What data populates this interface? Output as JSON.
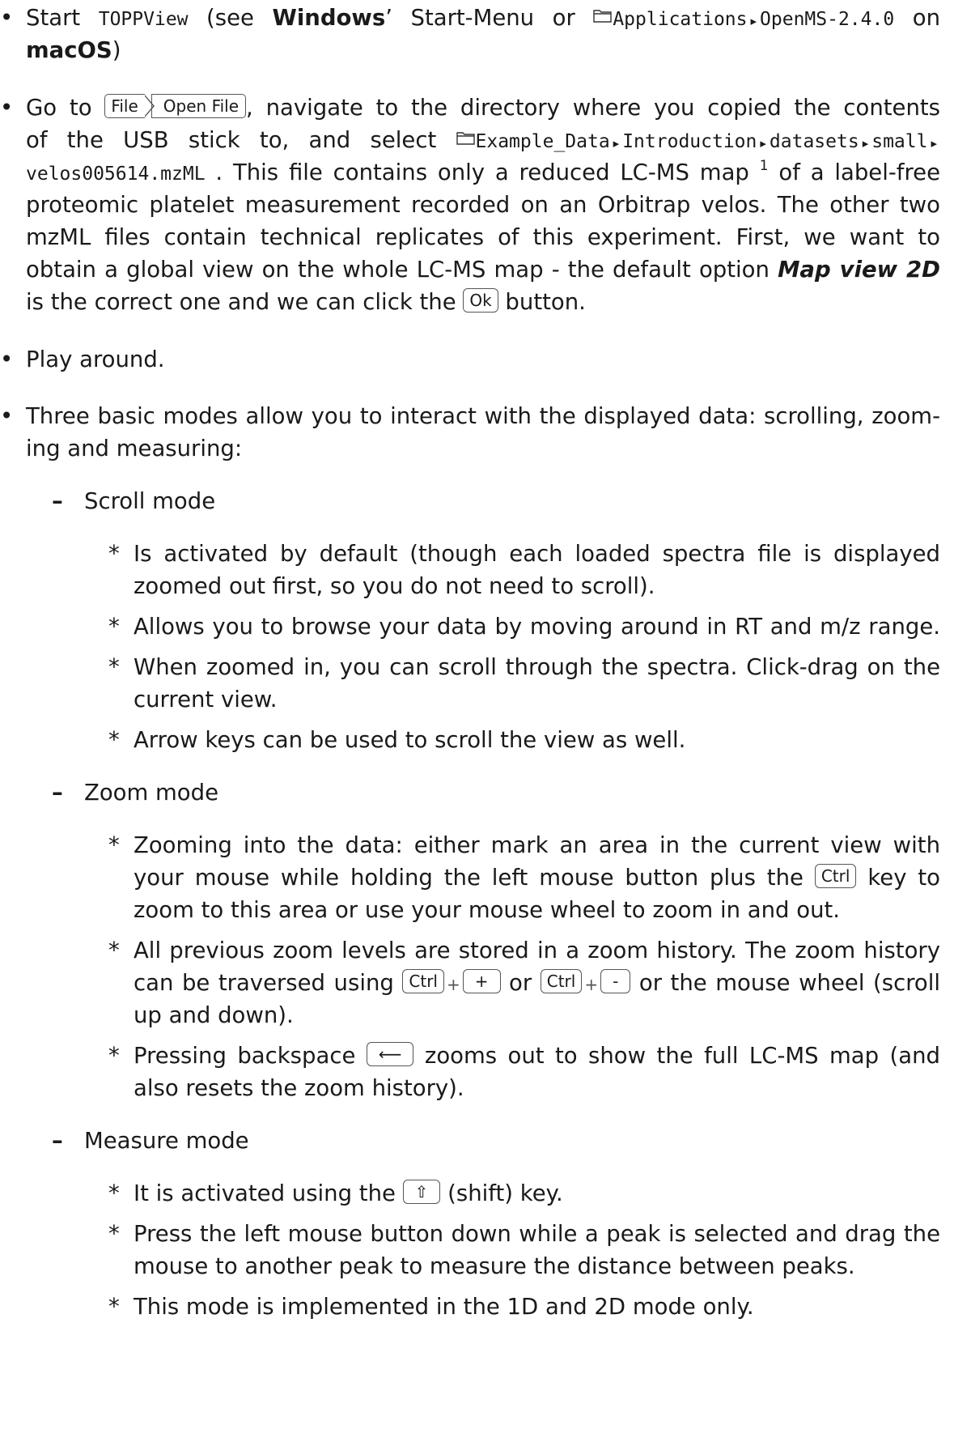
{
  "i1": {
    "a": "Start ",
    "tool": "TOPPView",
    "b": " (see ",
    "os1": "Windows",
    "c": "’ Start-Menu or ",
    "p1": "Applications",
    "p2": "OpenMS-2.4.0",
    "d": " on",
    "os2": "macOS",
    "e": ")"
  },
  "i2": {
    "a": "Go to ",
    "m1": "File",
    "m2": "Open File",
    "b": ", navigate to the directory where you copied the contents",
    "c": "of the USB stick to, and select ",
    "f1": "Example_Data",
    "f2": "Introduction",
    "f3": "datasets",
    "f4": "small",
    "f5": "velos005614.mzML",
    "d": " . This file contains only a reduced LC-MS map ",
    "fn": "1",
    "e": " of a label-free",
    "l3": "proteomic platelet measurement recorded on an Orbitrap velos. The other two",
    "l4": "mzML files contain technical replicates of this experiment.  First, we want to",
    "l5": "obtain a global view on the whole LC-MS map - the default option ",
    "l5em": "Map view 2D",
    "l6a": "is the correct one and we can click the ",
    "ok": "Ok",
    "l6b": " button."
  },
  "i3": {
    "t": "Play around."
  },
  "i4": {
    "l1": "Three basic modes allow you to interact with the displayed data: scrolling, zoom-",
    "l2": "ing and measuring:"
  },
  "scroll": {
    "title": "Scroll mode",
    "s1a": "Is activated by default (though each loaded spectra file is displayed",
    "s1b": "zoomed out first, so you do not need to scroll).",
    "s2": "Allows you to browse your data by moving around in RT and m/z range.",
    "s3a": "When zoomed in, you can scroll through the spectra. Click-drag on the",
    "s3b": "current view.",
    "s4": "Arrow keys can be used to scroll the view as well."
  },
  "zoom": {
    "title": "Zoom mode",
    "z1a": "Zooming into the data:  either mark an area in the current view with",
    "z1b1": "your mouse while holding the left mouse button plus the ",
    "ctrl": "Ctrl",
    "z1b2": " key to",
    "z1c": "zoom to this area or use your mouse wheel to zoom in and out.",
    "z2a": "All previous zoom levels are stored in a zoom history. The zoom history",
    "z2b1": "can be traversed using ",
    "plus": "+",
    "minus": "-",
    "or": " or ",
    "z2b2": " or the mouse wheel (scroll",
    "z2c": "up and down).",
    "z3a1": "Pressing backspace ",
    "bksp": "⟵",
    "z3a2": " zooms out to show the full LC-MS map (and",
    "z3b": "also resets the zoom history)."
  },
  "measure": {
    "title": "Measure mode",
    "m1a": "It is activated using the ",
    "shift": "⇧",
    "m1b": " (shift) key.",
    "m2a": "Press the left mouse button down while a peak is selected and drag the",
    "m2b": "mouse to another peak to measure the distance between peaks.",
    "m3": "This mode is implemented in the 1D and 2D mode only."
  },
  "symbols": {
    "bullet": "•",
    "dash": "–",
    "star": "*",
    "arrow": "▸",
    "plus_sep": "+"
  },
  "icons": {
    "folder": "folder-icon",
    "path_separator": "path-arrow-icon",
    "menu_separator": "chevron-right-icon"
  }
}
